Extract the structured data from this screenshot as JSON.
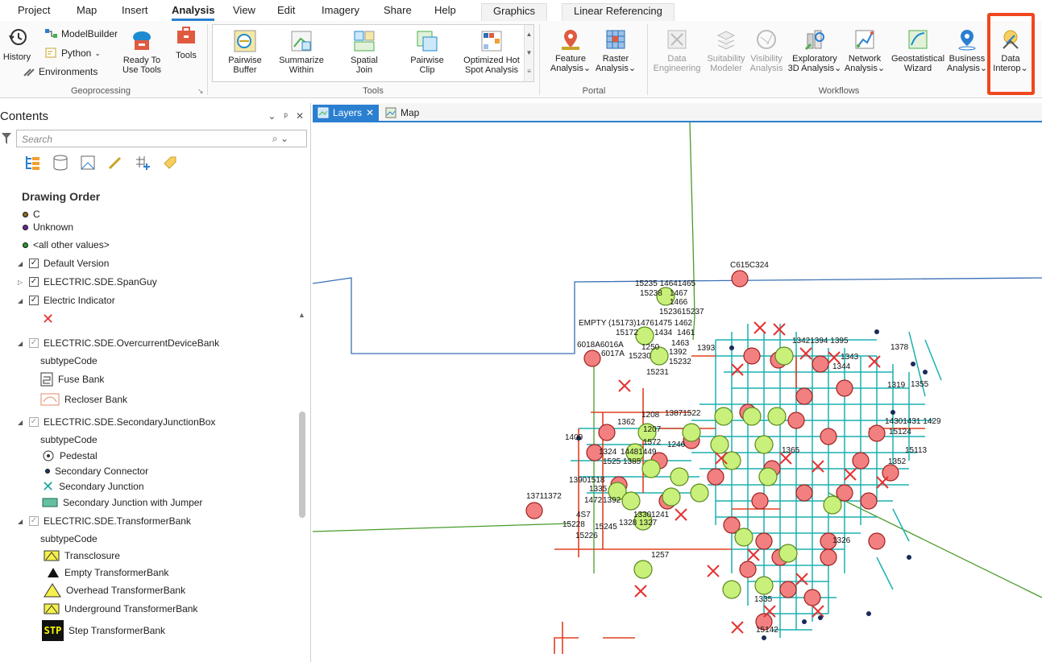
{
  "ribbon_tabs": [
    "Project",
    "Map",
    "Insert",
    "Analysis",
    "View",
    "Edit",
    "Imagery",
    "Share",
    "Help",
    "Graphics",
    "Linear Referencing"
  ],
  "active_tab": "Analysis",
  "geoprocessing": {
    "history": "History",
    "modelbuilder": "ModelBuilder",
    "python": "Python",
    "environments": "Environments",
    "ready_to_use_1": "Ready To",
    "ready_to_use_2": "Use Tools",
    "tools": "Tools",
    "group_label": "Geoprocessing"
  },
  "tools_group": {
    "buttons": [
      {
        "l1": "Pairwise",
        "l2": "Buffer"
      },
      {
        "l1": "Summarize",
        "l2": "Within"
      },
      {
        "l1": "Spatial",
        "l2": "Join"
      },
      {
        "l1": "Pairwise",
        "l2": "Clip"
      },
      {
        "l1": "Optimized Hot",
        "l2": "Spot Analysis"
      }
    ],
    "group_label": "Tools"
  },
  "portal_group": {
    "feature_1": "Feature",
    "feature_2": "Analysis",
    "raster_1": "Raster",
    "raster_2": "Analysis",
    "group_label": "Portal"
  },
  "workflows_group": {
    "buttons": [
      {
        "l1": "Data",
        "l2": "Engineering"
      },
      {
        "l1": "Suitability",
        "l2": "Modeler"
      },
      {
        "l1": "Visibility",
        "l2": "Analysis"
      },
      {
        "l1": "Exploratory",
        "l2": "3D Analysis"
      },
      {
        "l1": "Network",
        "l2": "Analysis"
      },
      {
        "l1": "Geostatistical",
        "l2": "Wizard"
      },
      {
        "l1": "Business",
        "l2": "Analysis"
      },
      {
        "l1": "Data",
        "l2": "Interop"
      }
    ],
    "group_label": "Workflows"
  },
  "contents": {
    "title": "Contents",
    "search_placeholder": "Search",
    "drawing_order": "Drawing Order",
    "items": {
      "c": "C",
      "unknown": "Unknown",
      "all_other": "<all other values>",
      "default_version": "Default Version",
      "span_guy": "ELECTRIC.SDE.SpanGuy",
      "electric_indicator": "Electric Indicator",
      "overcurrent": "ELECTRIC.SDE.OvercurrentDeviceBank",
      "subtype1": "subtypeCode",
      "fuse_bank": "Fuse Bank",
      "recloser_bank": "Recloser Bank",
      "secondary_jb": "ELECTRIC.SDE.SecondaryJunctionBox",
      "subtype2": "subtypeCode",
      "pedestal": "Pedestal",
      "sec_connector": "Secondary Connector",
      "sec_junction": "Secondary Junction",
      "sec_junction_jumper": "Secondary Junction with Jumper",
      "transformer_bank": "ELECTRIC.SDE.TransformerBank",
      "subtype3": "subtypeCode",
      "transclosure": "Transclosure",
      "empty_tb": "Empty TransformerBank",
      "overhead_tb": "Overhead TransformerBank",
      "underground_tb": "Underground TransformerBank",
      "step_tb": "Step TransformerBank",
      "stp_glyph": "STP"
    }
  },
  "map_tabs": {
    "layers": "Layers",
    "map": "Map"
  },
  "map_labels": {
    "c615c324": "C615C324",
    "l1": "15235 14641465",
    "l2": "15238",
    "l3": "1467",
    "l4": "1466",
    "l5": "1523615237",
    "empty": "EMPTY (15173)14761475 1462",
    "l6": "15172",
    "l7": "1434",
    "l8": "1461",
    "l9": "1463",
    "l10": "1250",
    "l11": "6018A6016A",
    "l12": "6017A",
    "l13": "15230",
    "l14": "1392",
    "l15": "1393",
    "l16": "15231",
    "l17": "15232",
    "l18": "13421394 1395",
    "l19": "1378",
    "l20": "1343",
    "l21": "1344",
    "l22": "1319",
    "l23": "1355",
    "l24": "14301431 1429",
    "l25": "15124",
    "l26": "15113",
    "l27": "1208",
    "l28": "13871522",
    "l29": "1362",
    "l30": "1207",
    "l31": "1572",
    "l32": "1246",
    "l33": "1409",
    "l34": "1324",
    "l35": "14481449",
    "l36": "1525",
    "l37": "1385",
    "l38": "13711372",
    "l39": "13901518",
    "l40": "1335",
    "l41": "1472",
    "l42": "1392",
    "l43": "4S7",
    "l44": "15228",
    "l45": "15245",
    "l46": "1328",
    "l47": "1327",
    "l48": "15226",
    "l49": "1330",
    "l50": "1241",
    "l51": "1257",
    "l52": "1365",
    "l53": "1352",
    "l54": "1326",
    "l55": "15142",
    "l56": "1335"
  },
  "colors": {
    "accent": "#2a7fd0",
    "highlight": "#f0471f",
    "red_marker": "#f28080",
    "green_marker": "#c8f07a",
    "cyan_network": "#1bb0b0"
  }
}
